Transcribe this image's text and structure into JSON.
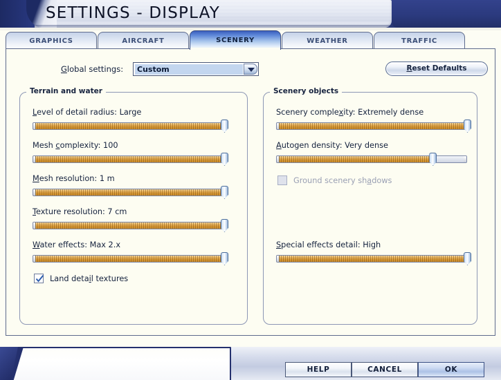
{
  "window": {
    "title": "SETTINGS - DISPLAY"
  },
  "tabs": [
    {
      "label": "GRAPHICS",
      "active": false
    },
    {
      "label": "AIRCRAFT",
      "active": false
    },
    {
      "label": "SCENERY",
      "active": true
    },
    {
      "label": "WEATHER",
      "active": false
    },
    {
      "label": "TRAFFIC",
      "active": false
    }
  ],
  "toolbar": {
    "global_settings_label": "Global settings:",
    "global_settings_accel": "G",
    "global_settings_value": "Custom",
    "global_settings_options": [
      "Custom"
    ],
    "reset_defaults_label": "Reset Defaults",
    "reset_defaults_accel": "R",
    "dropdown_icon": "chevron-down-icon"
  },
  "groups": {
    "terrain": {
      "title": "Terrain and water",
      "sliders": [
        {
          "label": "Level of detail radius: Large",
          "accel": "L",
          "name": "level-of-detail-radius",
          "percent": 100
        },
        {
          "label": "Mesh complexity: 100",
          "accel": "c",
          "name": "mesh-complexity",
          "percent": 100
        },
        {
          "label": "Mesh resolution: 1 m",
          "accel": "M",
          "name": "mesh-resolution",
          "percent": 100
        },
        {
          "label": "Texture resolution: 7 cm",
          "accel": "T",
          "name": "texture-resolution",
          "percent": 100
        },
        {
          "label": "Water effects: Max 2.x",
          "accel": "W",
          "name": "water-effects",
          "percent": 100
        }
      ],
      "checkboxes": [
        {
          "label": "Land detail textures",
          "accel": "i",
          "name": "land-detail-textures",
          "checked": true,
          "enabled": true
        }
      ]
    },
    "scenery_objects": {
      "title": "Scenery objects",
      "sliders": [
        {
          "label": "Scenery complexity: Extremely dense",
          "accel": "x",
          "name": "scenery-complexity",
          "percent": 100
        },
        {
          "label": "Autogen density: Very dense",
          "accel": "A",
          "name": "autogen-density",
          "percent": 82
        },
        {
          "label": "Special effects detail: High",
          "accel": "S",
          "name": "special-effects-detail",
          "percent": 100
        }
      ],
      "checkboxes": [
        {
          "label": "Ground scenery shadows",
          "accel": "a",
          "name": "ground-scenery-shadows",
          "checked": false,
          "enabled": false
        }
      ]
    }
  },
  "footer": {
    "buttons": [
      {
        "label": "HELP",
        "name": "help-button",
        "default": false
      },
      {
        "label": "CANCEL",
        "name": "cancel-button",
        "default": false
      },
      {
        "label": "OK",
        "name": "ok-button",
        "default": true
      }
    ]
  },
  "colors": {
    "title_bar_blue": "#2a3a7a",
    "slider_fill_orange": "#d79a38",
    "panel_background": "#fdfdf2",
    "accent_selection": "#c3d6ef"
  }
}
